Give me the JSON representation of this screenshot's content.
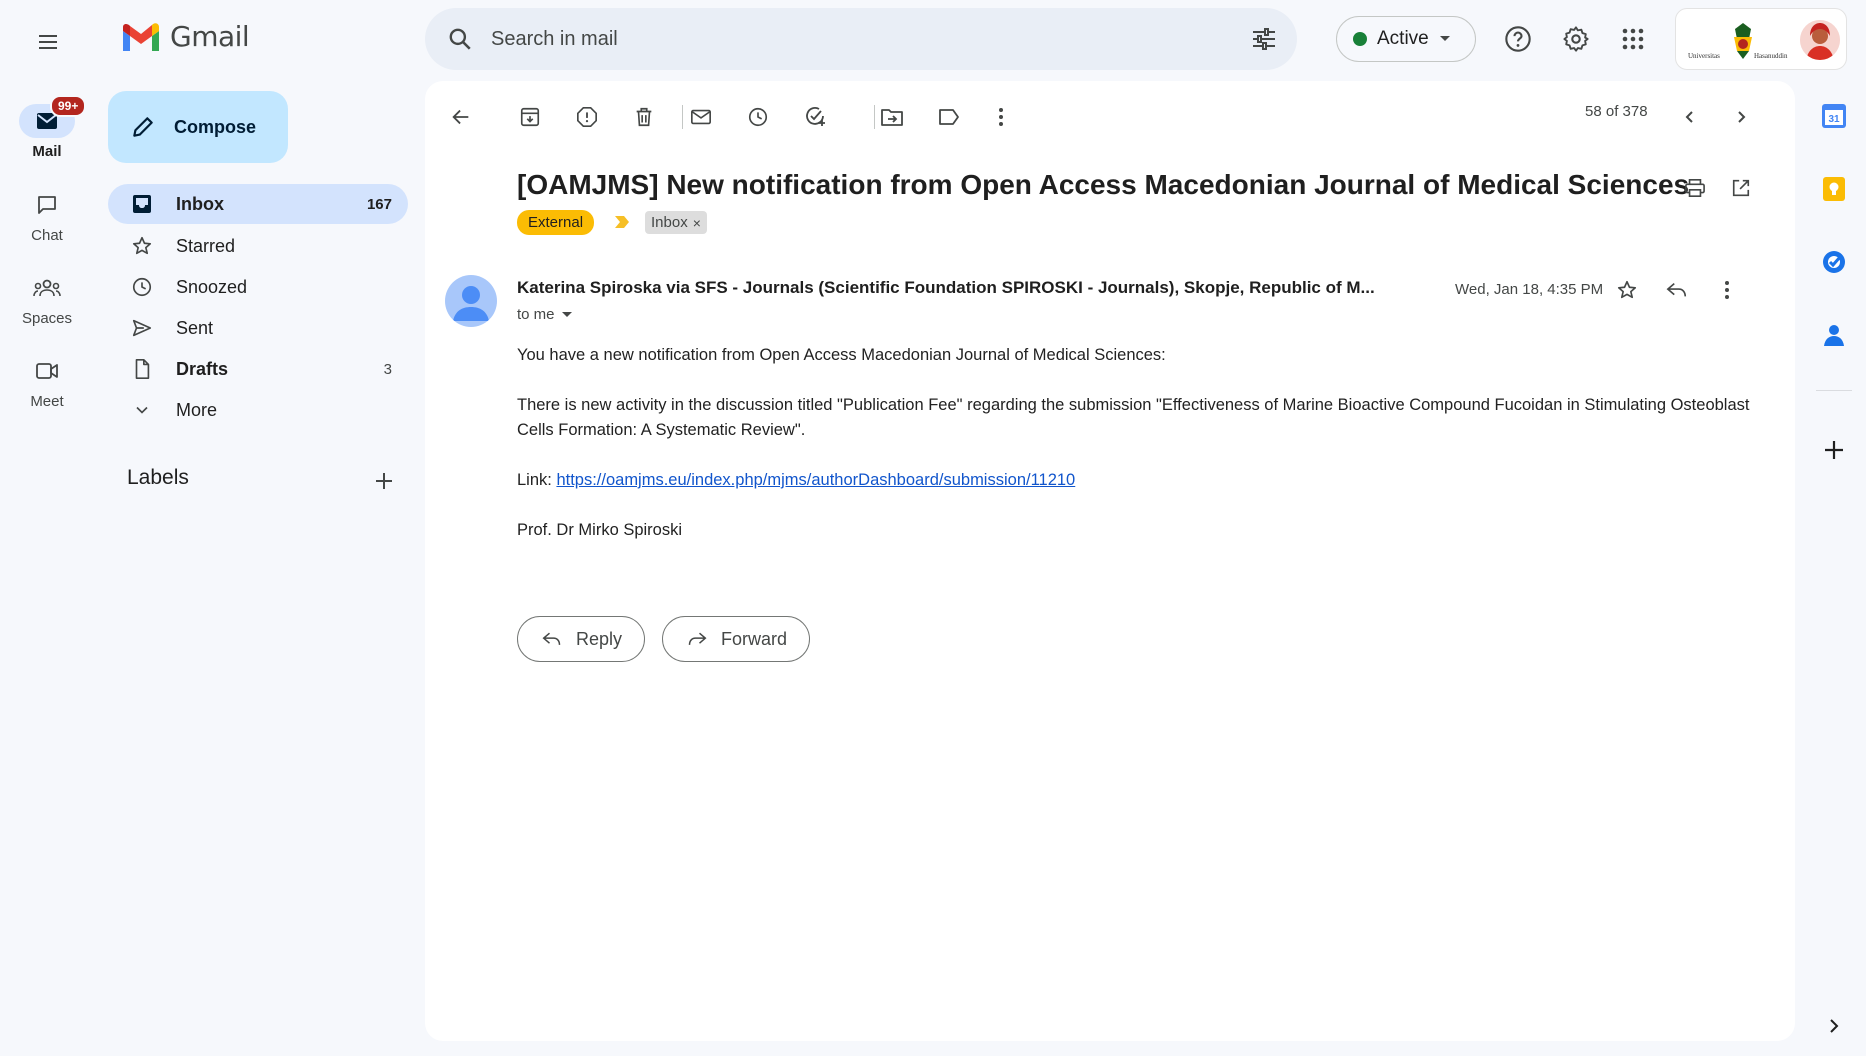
{
  "app": {
    "name": "Gmail"
  },
  "rail": {
    "mail_badge": "99+",
    "items": [
      {
        "label": "Mail",
        "icon": "mail-icon",
        "active": true
      },
      {
        "label": "Chat",
        "icon": "chat-icon",
        "active": false
      },
      {
        "label": "Spaces",
        "icon": "spaces-icon",
        "active": false
      },
      {
        "label": "Meet",
        "icon": "meet-icon",
        "active": false
      }
    ]
  },
  "nav": {
    "compose_label": "Compose",
    "items": [
      {
        "label": "Inbox",
        "count": "167",
        "icon": "inbox-icon"
      },
      {
        "label": "Starred",
        "count": "",
        "icon": "star-icon"
      },
      {
        "label": "Snoozed",
        "count": "",
        "icon": "clock-icon"
      },
      {
        "label": "Sent",
        "count": "",
        "icon": "send-icon"
      },
      {
        "label": "Drafts",
        "count": "3",
        "icon": "draft-icon"
      },
      {
        "label": "More",
        "count": "",
        "icon": "chevron-down-icon"
      }
    ],
    "labels_heading": "Labels"
  },
  "search": {
    "placeholder": "Search in mail"
  },
  "status": {
    "label": "Active",
    "color": "#188038"
  },
  "toolbar": {
    "counter": "58 of 378"
  },
  "email": {
    "subject": "[OAMJMS] New notification from Open Access Macedonian Journal of Medical Sciences",
    "tags": {
      "external": "External",
      "inbox": "Inbox",
      "inbox_remove": "×"
    },
    "sender": "Katerina Spiroska via SFS - Journals (Scientific Foundation SPIROSKI - Journals), Skopje, Republic of M...",
    "date": "Wed, Jan 18, 4:35 PM",
    "to": "to me",
    "body": {
      "line1": "You have a new notification from Open Access Macedonian Journal of Medical Sciences:",
      "line2": "There is new activity in the discussion titled \"Publication Fee\" regarding the submission \"Effectiveness of Marine Bioactive Compound Fucoidan in Stimulating Osteoblast Cells Formation: A Systematic Review\".",
      "link_prefix": "Link: ",
      "link": "https://oamjms.eu/index.php/mjms/authorDashboard/submission/11210",
      "signature": "Prof. Dr Mirko Spiroski"
    },
    "actions": {
      "reply": "Reply",
      "forward": "Forward"
    }
  },
  "account": {
    "org_text_left": "Universitas",
    "org_text_right": "Hasanuddin"
  },
  "side_panel": {
    "calendar_day": "31"
  },
  "colors": {
    "compose_bg": "#c2e7ff",
    "nav_active_bg": "#d3e3fd",
    "external_tag": "#fbbc04",
    "link": "#1155cc",
    "badge": "#b3261e"
  }
}
